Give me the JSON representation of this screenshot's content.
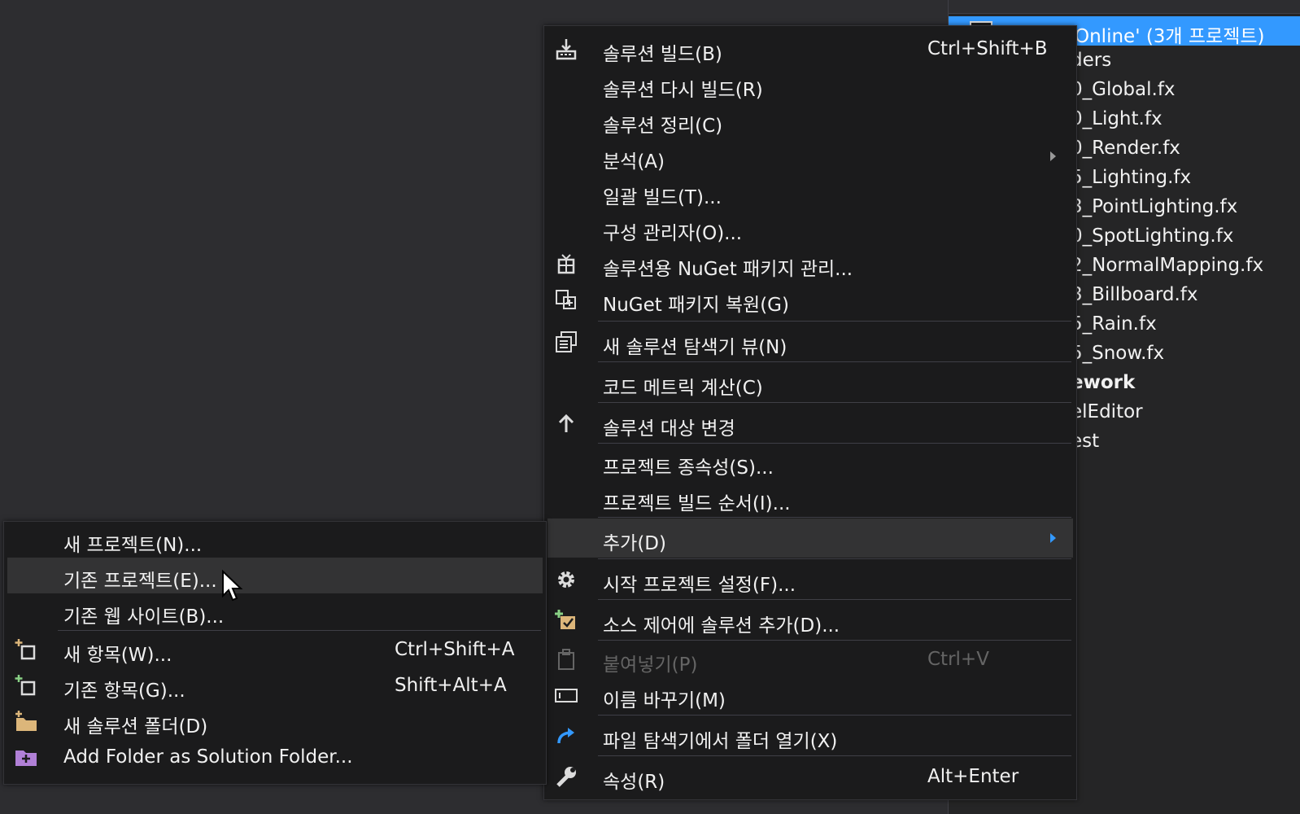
{
  "explorer": {
    "selected_text": "Online' (3개 프로젝트)",
    "items": [
      "ders",
      "0_Global.fx",
      "0_Light.fx",
      "0_Render.fx",
      "5_Lighting.fx",
      "3_PointLighting.fx",
      "0_SpotLighting.fx",
      "2_NormalMapping.fx",
      "3_Billboard.fx",
      "5_Rain.fx",
      "5_Snow.fx",
      "ework",
      "elEditor",
      "est"
    ]
  },
  "main_menu": {
    "build": {
      "label": "솔루션 빌드(B)",
      "shortcut": "Ctrl+Shift+B"
    },
    "rebuild": {
      "label": "솔루션 다시 빌드(R)"
    },
    "clean": {
      "label": "솔루션 정리(C)"
    },
    "analyze": {
      "label": "분석(A)"
    },
    "batch": {
      "label": "일괄 빌드(T)..."
    },
    "config": {
      "label": "구성 관리자(O)..."
    },
    "nuget_manage": {
      "label": "솔루션용 NuGet 패키지 관리..."
    },
    "nuget_restore": {
      "label": "NuGet 패키지 복원(G)"
    },
    "new_view": {
      "label": "새 솔루션 탐색기 뷰(N)"
    },
    "code_metrics": {
      "label": "코드 메트릭 계산(C)"
    },
    "retarget": {
      "label": "솔루션 대상 변경"
    },
    "dependencies": {
      "label": "프로젝트 종속성(S)..."
    },
    "build_order": {
      "label": "프로젝트 빌드 순서(I)..."
    },
    "add": {
      "label": "추가(D)"
    },
    "startup": {
      "label": "시작 프로젝트 설정(F)..."
    },
    "source_control": {
      "label": "소스 제어에 솔루션 추가(D)..."
    },
    "paste": {
      "label": "붙여넣기(P)",
      "shortcut": "Ctrl+V"
    },
    "rename": {
      "label": "이름 바꾸기(M)"
    },
    "open_folder": {
      "label": "파일 탐색기에서 폴더 열기(X)"
    },
    "properties": {
      "label": "속성(R)",
      "shortcut": "Alt+Enter"
    }
  },
  "sub_menu": {
    "new_project": {
      "label": "새 프로젝트(N)..."
    },
    "existing_project": {
      "label": "기존 프로젝트(E)..."
    },
    "existing_website": {
      "label": "기존 웹 사이트(B)..."
    },
    "new_item": {
      "label": "새 항목(W)...",
      "shortcut": "Ctrl+Shift+A"
    },
    "existing_item": {
      "label": "기존 항목(G)...",
      "shortcut": "Shift+Alt+A"
    },
    "new_folder": {
      "label": "새 솔루션 폴더(D)"
    },
    "add_folder": {
      "label": "Add Folder as Solution Folder..."
    }
  },
  "colors": {
    "accent": "#3399ff",
    "menu_bg": "#1b1b1c",
    "highlight": "#333334",
    "add_icon_green": "#89d185",
    "folder_yellow": "#dcb67a",
    "purple_folder": "#b180d7"
  },
  "icons": {
    "build": "build-icon",
    "nuget_manage": "nuget-package-icon",
    "nuget_restore": "nuget-restore-icon",
    "new_view": "solution-explorer-view-icon",
    "retarget": "up-arrow-icon",
    "startup": "gear-icon",
    "source_control": "source-control-add-icon",
    "paste": "paste-icon",
    "rename": "rename-icon",
    "open_folder": "redo-arrow-icon",
    "properties": "wrench-icon"
  }
}
